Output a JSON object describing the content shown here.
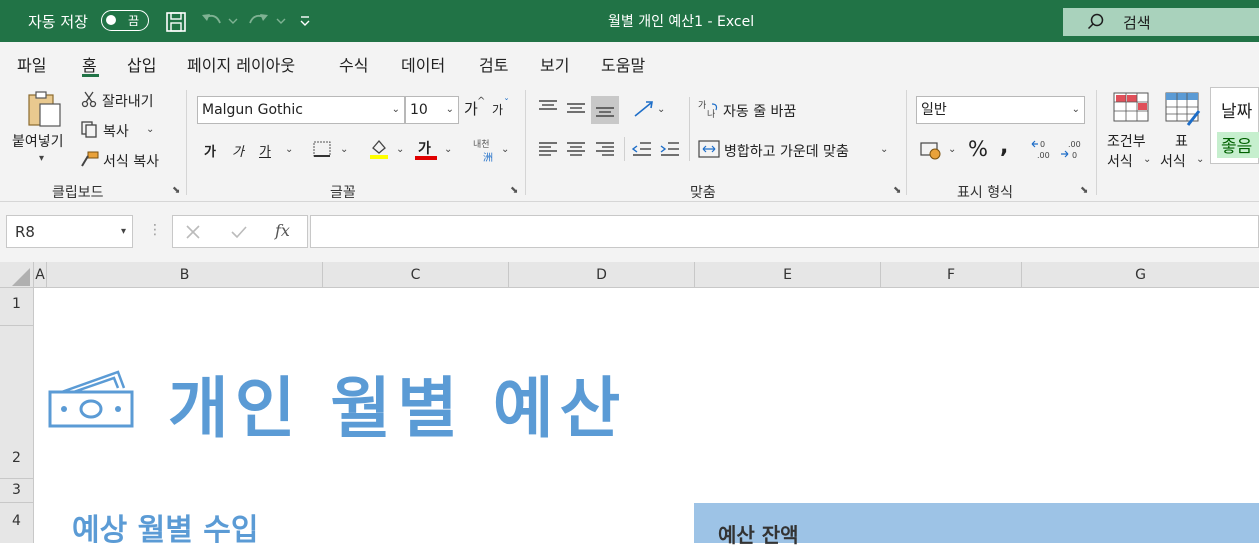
{
  "titlebar": {
    "autosave_label": "자동 저장",
    "autosave_state": "끔",
    "doc_title": "월별 개인 예산1  -  Excel",
    "search_placeholder": "검색"
  },
  "menu": [
    "파일",
    "홈",
    "삽입",
    "페이지 레이아웃",
    "수식",
    "데이터",
    "검토",
    "보기",
    "도움말"
  ],
  "ribbon": {
    "clipboard": {
      "paste": "붙여넣기",
      "cut": "잘라내기",
      "copy": "복사",
      "format_painter": "서식 복사",
      "group": "클립보드"
    },
    "font": {
      "name": "Malgun Gothic",
      "size": "10",
      "grow": "가",
      "shrink": "가",
      "bold": "가",
      "italic": "가",
      "underline": "가",
      "fontcolor": "가",
      "phonetic": "내천",
      "group": "글꼴"
    },
    "align": {
      "wrap": "자동 줄 바꿈",
      "merge": "병합하고 가운데 맞춤",
      "group": "맞춤"
    },
    "number": {
      "format": "일반",
      "group": "표시 형식"
    },
    "styles": {
      "cond_format_1": "조건부",
      "cond_format_2": "서식",
      "table_1": "표",
      "table_2": "서식",
      "date": "날짜",
      "good": "좋음"
    }
  },
  "formula": {
    "namebox": "R8",
    "fx": "fx",
    "value": ""
  },
  "columns": [
    "A",
    "B",
    "C",
    "D",
    "E",
    "F",
    "G"
  ],
  "rows": [
    "1",
    "2",
    "3",
    "4"
  ],
  "sheet": {
    "title": "개인 월별 예산",
    "section_income": "예상 월별 수입",
    "section_balance": "예산 잔액"
  },
  "colors": {
    "excel_green": "#217346",
    "title_blue": "#5b9bd5",
    "balance_fill": "#9dc3e6",
    "good_fill": "#c6efce"
  }
}
